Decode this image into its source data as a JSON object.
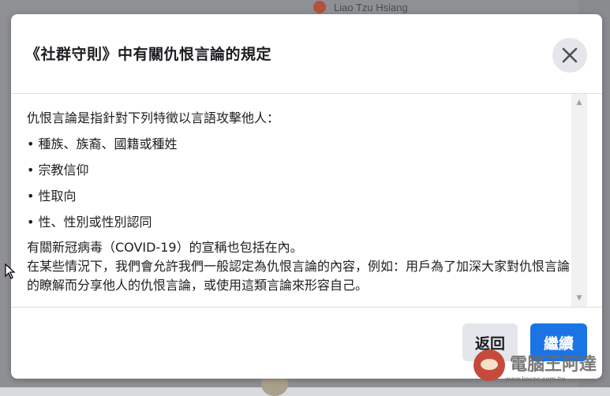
{
  "background": {
    "post_user_name": "Liao Tzu Hsiang"
  },
  "dialog": {
    "title": "《社群守則》中有關仇恨言論的規定",
    "close_icon": "close-icon",
    "body": {
      "intro": "仇恨言論是指針對下列特徵以言語攻擊他人：",
      "bullets": [
        "種族、族裔、國籍或種姓",
        "宗教信仰",
        "性取向",
        "性、性別或性別認同"
      ],
      "covid_note": "有關新冠病毒（COVID-19）的宣稱也包括在內。",
      "exception_note": "在某些情況下，我們會允許我們一般認定為仇恨言論的內容，例如：用戶為了加深大家對仇恨言論的瞭解而分享他人的仇恨言論，或使用這類言論來形容自己。"
    },
    "footer": {
      "back_label": "返回",
      "continue_label": "繼續"
    }
  },
  "watermark": {
    "text": "電腦王阿達",
    "url": "www.kocpc.com.tw"
  },
  "colors": {
    "primary_button": "#1b74e4",
    "secondary_button": "#e4e6eb",
    "text": "#1c1e21",
    "overlay": "#8f9094"
  }
}
